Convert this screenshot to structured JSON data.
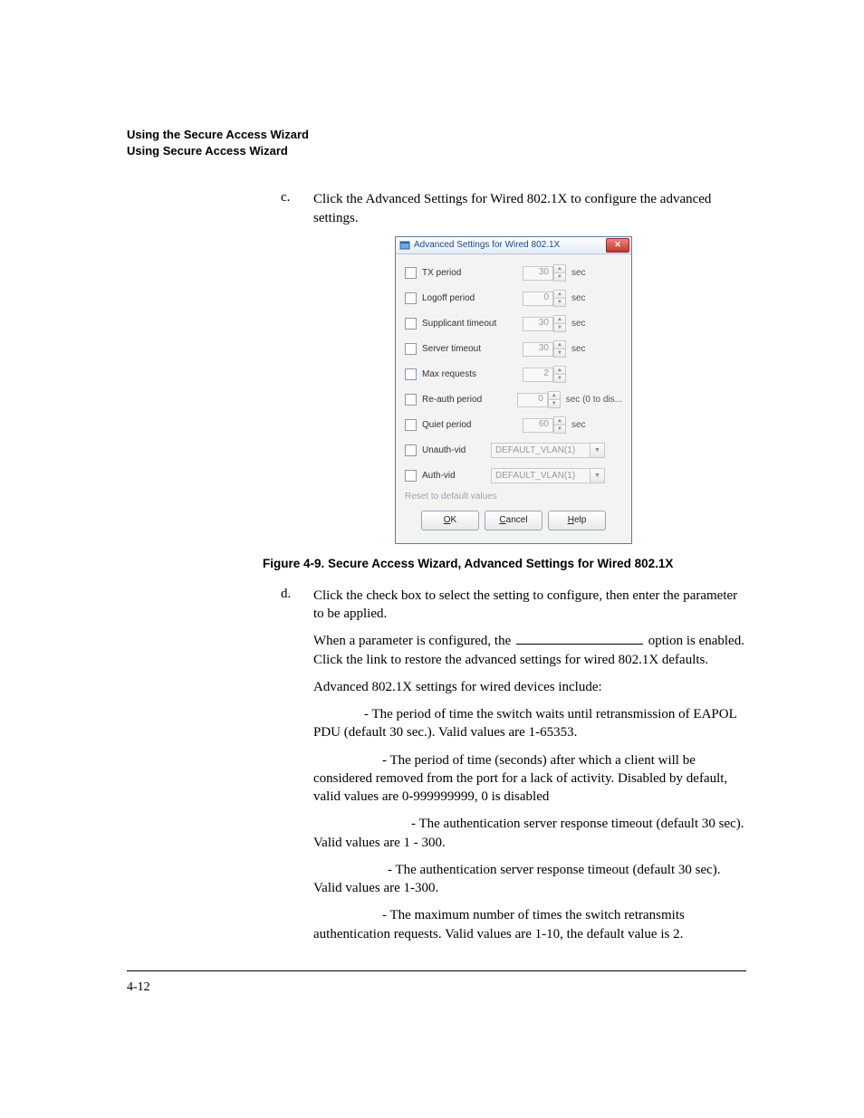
{
  "header": {
    "line1": "Using the Secure Access Wizard",
    "line2": "Using Secure Access Wizard"
  },
  "step_c": {
    "marker": "c.",
    "text": "Click the Advanced Settings for Wired 802.1X to configure the advanced settings."
  },
  "dialog": {
    "title": "Advanced Settings for Wired 802.1X",
    "rows": [
      {
        "label": "TX period",
        "value": "30",
        "unit": "sec"
      },
      {
        "label": "Logoff period",
        "value": "0",
        "unit": "sec"
      },
      {
        "label": "Supplicant timeout",
        "value": "30",
        "unit": "sec"
      },
      {
        "label": "Server timeout",
        "value": "30",
        "unit": "sec"
      },
      {
        "label": "Max requests",
        "value": "2",
        "unit": ""
      },
      {
        "label": "Re-auth period",
        "value": "0",
        "unit": "sec (0 to dis..."
      },
      {
        "label": "Quiet period",
        "value": "60",
        "unit": "sec"
      }
    ],
    "vlan_rows": [
      {
        "label": "Unauth-vid",
        "value": "DEFAULT_VLAN(1)"
      },
      {
        "label": "Auth-vid",
        "value": "DEFAULT_VLAN(1)"
      }
    ],
    "reset_link": "Reset to default values",
    "buttons": {
      "ok": "OK",
      "cancel": "Cancel",
      "help": "Help"
    }
  },
  "figure_caption": "Figure 4-9. Secure Access Wizard, Advanced Settings for Wired 802.1X",
  "step_d": {
    "marker": "d.",
    "p1": "Click the check box to select the setting to configure, then enter the parameter to be applied.",
    "p2a": "When a parameter is configured, the ",
    "p2b": " option is enabled. Click the link to restore the advanced settings for wired 802.1X defaults.",
    "p3": "Advanced 802.1X settings for wired devices include:",
    "b1": " - The period of time the switch waits until retransmission of EAPOL PDU (default 30 sec.). Valid values are 1-65353.",
    "b2": " - The period of time (seconds) after which a client will be considered removed from the port for a lack of activity. Disabled by default, valid values are 0-999999999, 0 is disabled",
    "b3": " - The authentication server response timeout (default 30 sec). Valid values are 1 - 300.",
    "b4": " - The authentication server response timeout (default 30 sec). Valid values are 1-300.",
    "b5": " - The maximum number of times the switch retransmits authentication requests. Valid values are 1-10, the default value is 2."
  },
  "page_number": "4-12"
}
